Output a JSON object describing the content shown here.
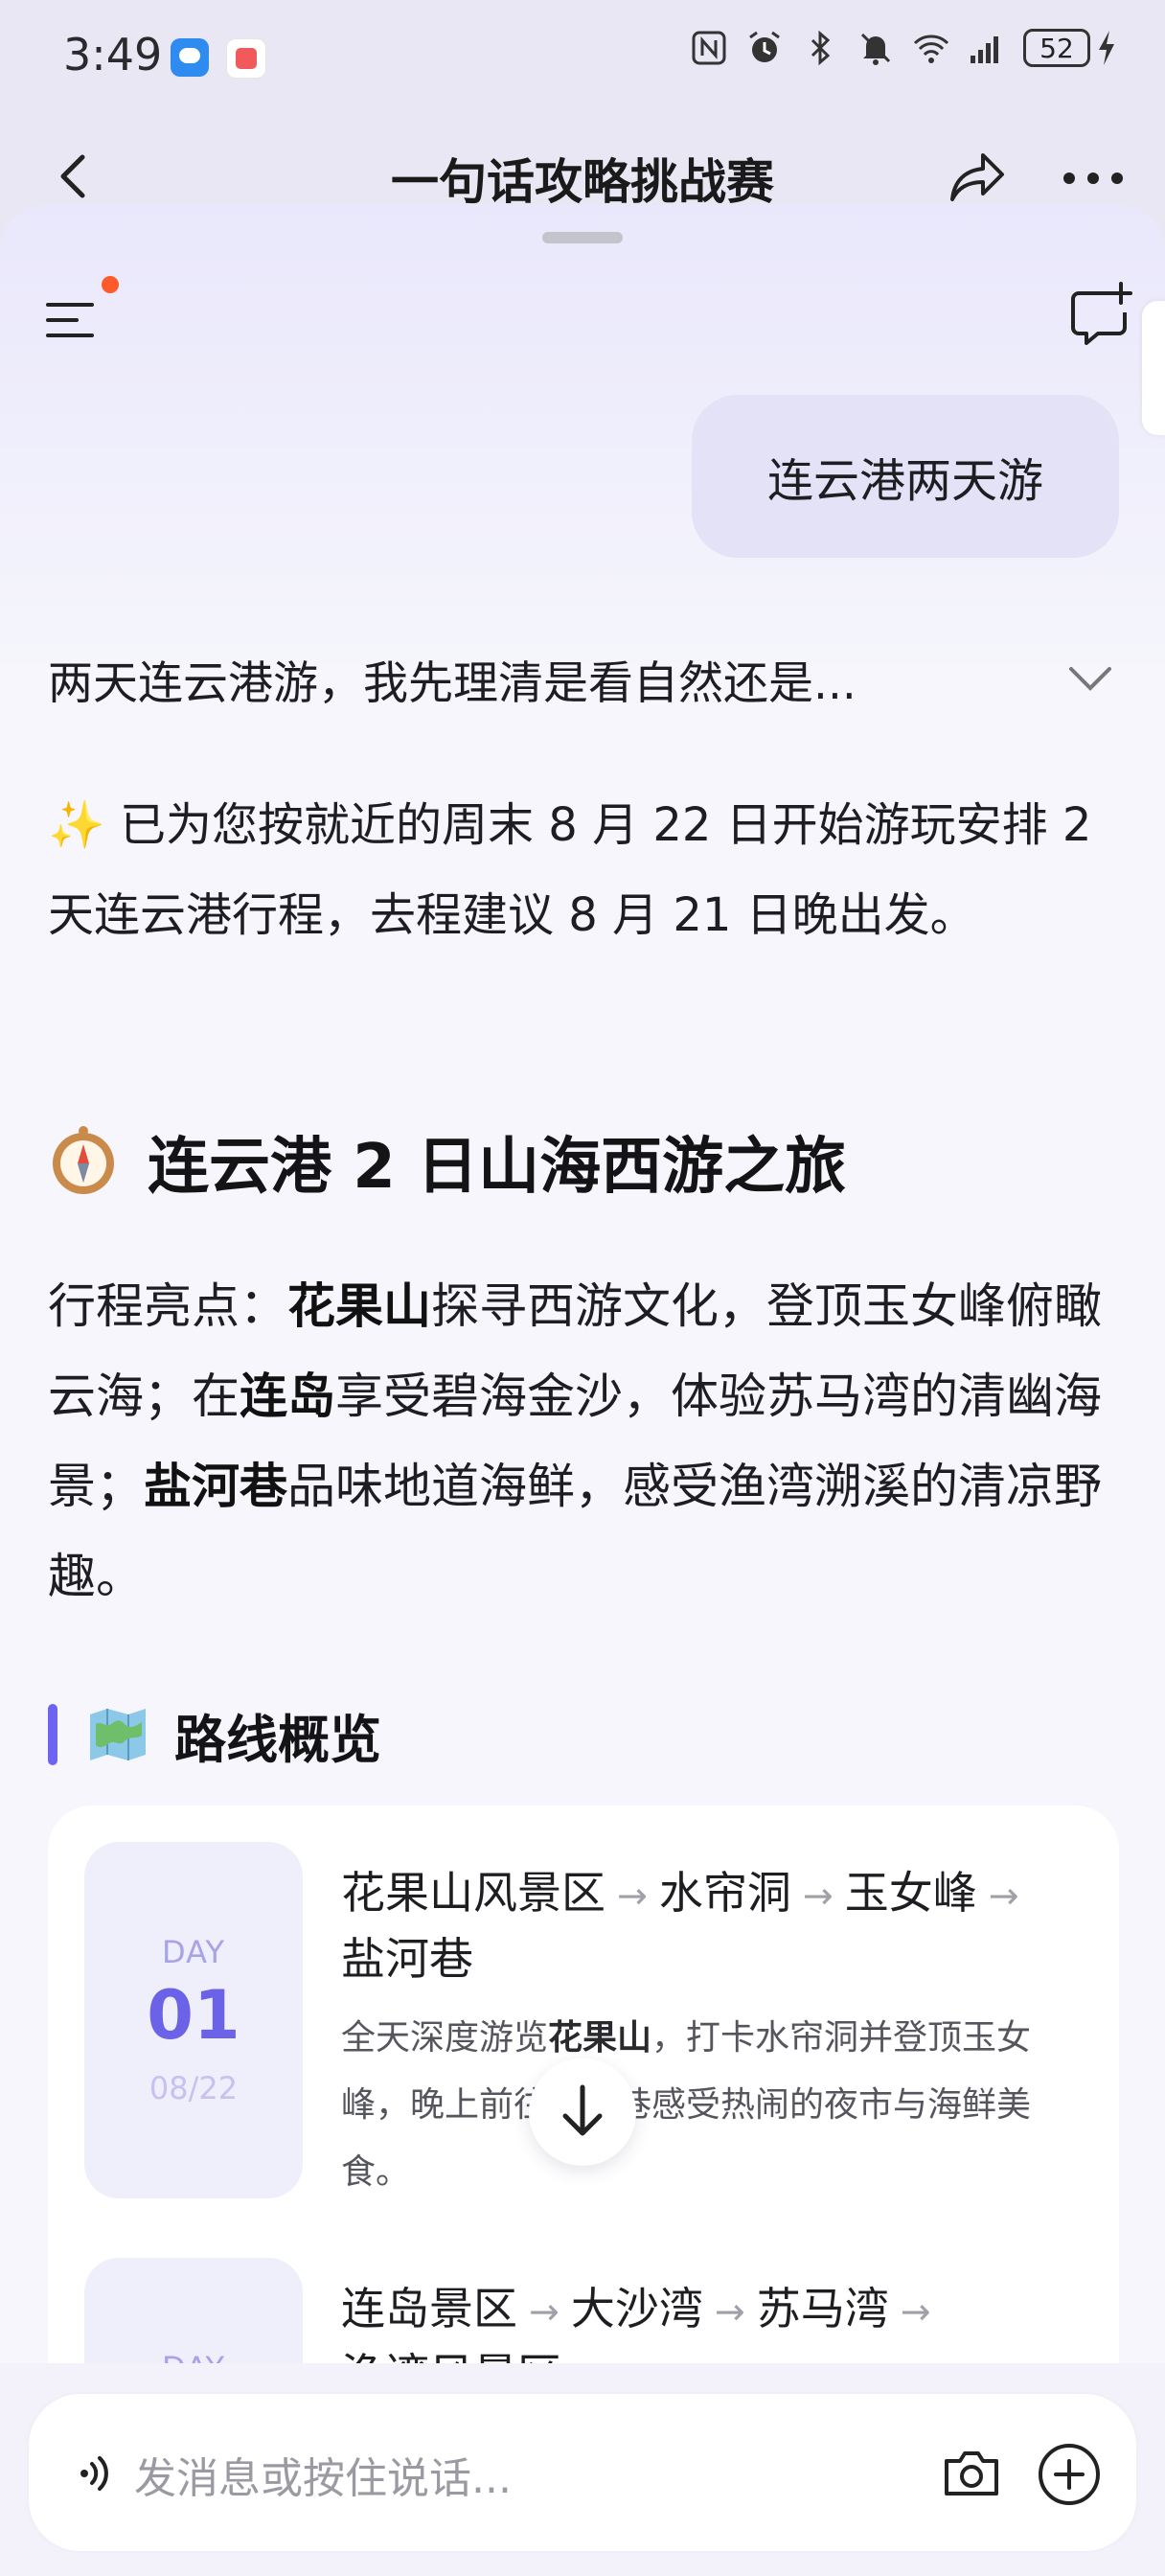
{
  "status_bar": {
    "time": "3:49",
    "battery": "52",
    "icons": [
      "nfc-icon",
      "alarm-icon",
      "bluetooth-icon",
      "mute-icon",
      "wifi-icon",
      "signal-icon",
      "charging-icon"
    ]
  },
  "header": {
    "title": "一句话攻略挑战赛",
    "icons": [
      "back-icon",
      "share-icon",
      "more-icon"
    ]
  },
  "chat": {
    "user_message": "连云港两天游",
    "thinking_summary": "两天连云港游，我先理清是看自然还是...",
    "intro": {
      "sparkle": "✨",
      "text": " 已为您按就近的周末 8 月 22 日开始游玩安排 2 天连云港行程，去程建议 8 月 21 日晚出发。"
    },
    "trip_title": "连云港 2 日山海西游之旅",
    "highlights": {
      "p1": "行程亮点：",
      "b1": "花果山",
      "p2": "探寻西游文化，登顶玉女峰俯瞰云海；在",
      "b2": "连岛",
      "p3": "享受碧海金沙，体验苏马湾的清幽海景；",
      "b3": "盐河巷",
      "p4": "品味地道海鲜，感受渔湾溯溪的清凉野趣。"
    },
    "route_section_title": "路线概览",
    "days": [
      {
        "label": "DAY",
        "num": "01",
        "date": "08/22",
        "stops": [
          "花果山风景区",
          "水帘洞",
          "玉女峰",
          "盐河巷"
        ],
        "desc_pre": "全天深度游览",
        "desc_bold": "花果山",
        "desc_post": "，打卡水帘洞并登顶玉女峰，晚上前往盐河巷感受热闹的夜市与海鲜美食。"
      },
      {
        "label": "DAY",
        "stops": [
          "连岛景区",
          "大沙湾",
          "苏马湾",
          "渔湾风景区"
        ]
      }
    ]
  },
  "input": {
    "placeholder": "发消息或按住说话..."
  },
  "colors": {
    "accent": "#6c62e8",
    "notification_dot": "#ff5a2a",
    "sheet_bg": "#f6f6fc"
  }
}
